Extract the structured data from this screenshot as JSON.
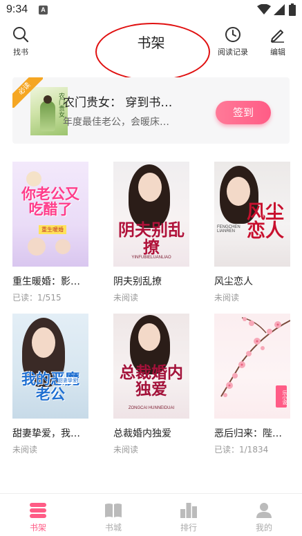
{
  "status_bar": {
    "time": "9:34",
    "notification_icon": "A"
  },
  "toolbar": {
    "search_label": "找书",
    "title": "书架",
    "history_label": "阅读记录",
    "edit_label": "编辑"
  },
  "featured": {
    "badge": "必读",
    "cover_text": "农门贵女",
    "title": "农门贵女： 穿到书…",
    "description": "年度最佳老公，会暖床…",
    "signin_label": "签到"
  },
  "books": [
    {
      "title": "重生暖婚：影…",
      "status": "已读：1/515",
      "cover_text": "你老公又吃醋了",
      "cover_sub": "重生暖婚"
    },
    {
      "title": "阴夫别乱撩",
      "status": "未阅读",
      "cover_text": "阴夫别乱撩",
      "cover_sub": "YINFUBIELUANLIAO"
    },
    {
      "title": "风尘恋人",
      "status": "未阅读",
      "cover_text": "风尘恋人",
      "cover_sub": "FENGCHEN LIANREN"
    },
    {
      "title": "甜妻挚爱，我…",
      "status": "未阅读",
      "cover_text": "我的恶魔老公",
      "cover_sub": "甜妻挚爱"
    },
    {
      "title": "总裁婚内独爱",
      "status": "未阅读",
      "cover_text": "总裁婚内独爱",
      "cover_sub": "ZONGCAI HUNNEIDUAI"
    },
    {
      "title": "恶后归来：陛…",
      "status": "已读：1/1834",
      "cover_text": "乐小说",
      "cover_sub": ""
    }
  ],
  "bottom_nav": [
    {
      "label": "书架",
      "icon": "bookshelf-icon",
      "active": true
    },
    {
      "label": "书城",
      "icon": "book-open-icon",
      "active": false
    },
    {
      "label": "排行",
      "icon": "ranking-icon",
      "active": false
    },
    {
      "label": "我的",
      "icon": "profile-icon",
      "active": false
    }
  ],
  "colors": {
    "accent": "#ff5c86",
    "annotation": "#e01010",
    "inactive": "#aaaaaa"
  }
}
